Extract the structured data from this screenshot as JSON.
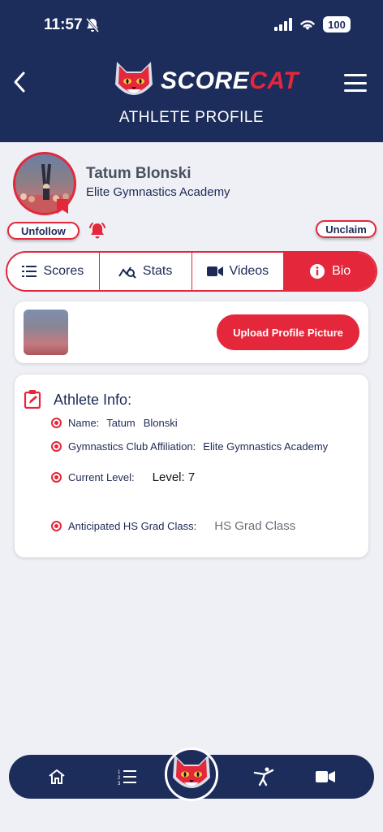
{
  "status_bar": {
    "time": "11:57",
    "battery": "100"
  },
  "header": {
    "brand_white": "SCORE",
    "brand_red": "CAT",
    "title": "ATHLETE PROFILE"
  },
  "athlete": {
    "name": "Tatum Blonski",
    "club": "Elite Gymnastics Academy"
  },
  "actions": {
    "unfollow": "Unfollow",
    "unclaim": "Unclaim"
  },
  "tabs": [
    {
      "label": "Scores",
      "icon": "list-numbered-icon"
    },
    {
      "label": "Stats",
      "icon": "chart-search-icon"
    },
    {
      "label": "Videos",
      "icon": "video-camera-icon"
    },
    {
      "label": "Bio",
      "icon": "info-circle-icon",
      "active": true
    }
  ],
  "upload": {
    "button_label": "Upload Profile Picture"
  },
  "info": {
    "title": "Athlete Info:",
    "name_label": "Name:",
    "first_name": "Tatum",
    "last_name": "Blonski",
    "club_label": "Gymnastics Club Affiliation:",
    "club_value": "Elite Gymnastics Academy",
    "level_label": "Current Level:",
    "level_value": "Level: 7",
    "grad_label": "Anticipated HS Grad Class:",
    "grad_placeholder": "HS Grad Class"
  },
  "bottom_nav": [
    "home-icon",
    "list-numbered-icon",
    "scorecat-logo",
    "gymnast-icon",
    "video-camera-icon"
  ],
  "colors": {
    "navy": "#1c2c5b",
    "accent_red": "#e4273a",
    "background": "#eef0f5"
  }
}
